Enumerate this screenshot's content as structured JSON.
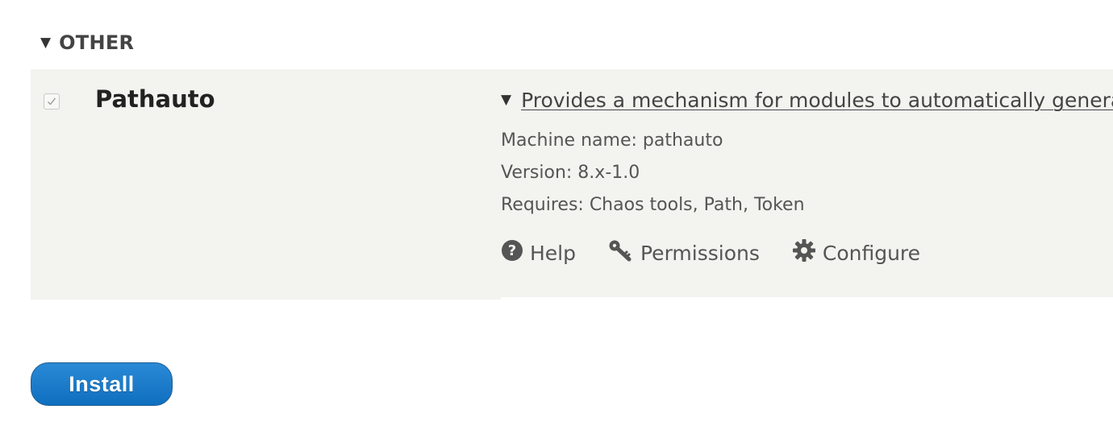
{
  "group": {
    "label": "OTHER",
    "toggle_icon": "triangle-down-icon"
  },
  "module": {
    "checked": true,
    "name": "Pathauto",
    "description_summary": "Provides a mechanism for modules to automatically generate aliases for the content they manage.",
    "machine_name": "Machine name: pathauto",
    "version": "Version: 8.x-1.0",
    "requires": "Requires: Chaos tools, Path, Token",
    "links": [
      {
        "label": "Help",
        "icon": "question-circle-icon"
      },
      {
        "label": "Permissions",
        "icon": "key-icon"
      },
      {
        "label": "Configure",
        "icon": "gear-icon"
      }
    ]
  },
  "install_button": {
    "label": "Install",
    "color": "#0f6fbf"
  },
  "colors": {
    "row_background": "#f3f3ef",
    "text": "#555555"
  }
}
